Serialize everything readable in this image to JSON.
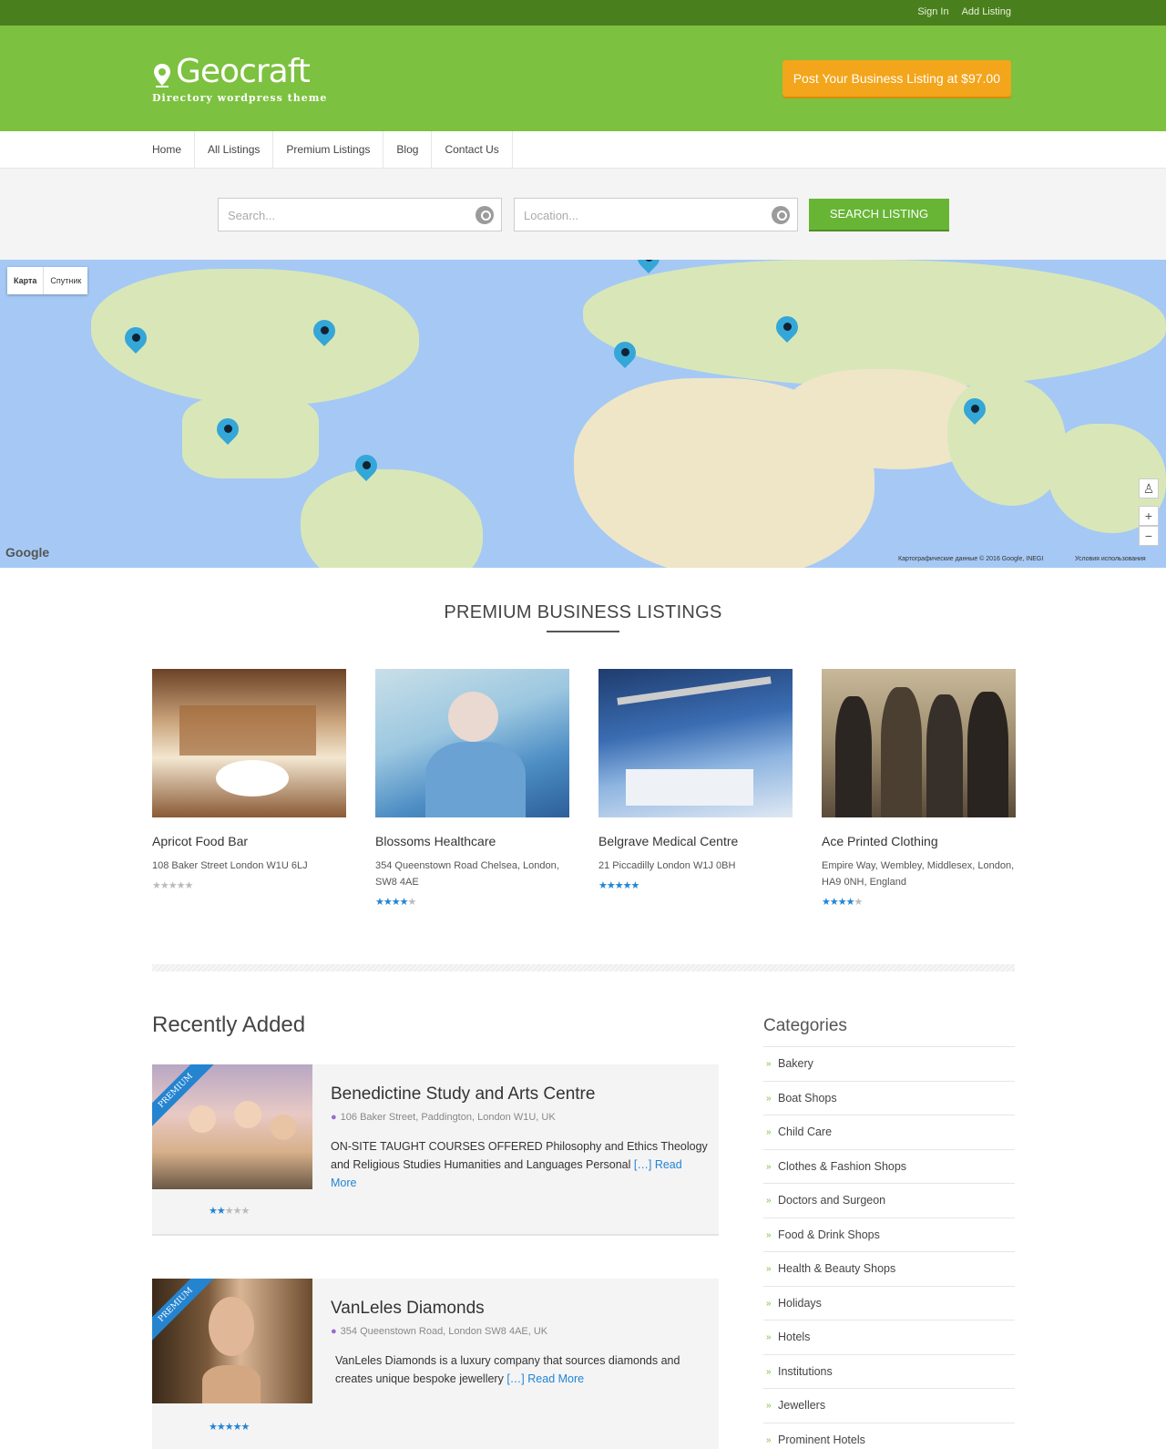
{
  "topbar": {
    "sign_in": "Sign In",
    "add_listing": "Add Listing"
  },
  "header": {
    "logo_name": "Geocraft",
    "logo_tagline": "Directory wordpress theme",
    "post_button": "Post Your Business Listing at $97.00"
  },
  "nav": [
    "Home",
    "All Listings",
    "Premium Listings",
    "Blog",
    "Contact Us"
  ],
  "search": {
    "keyword_placeholder": "Search...",
    "location_placeholder": "Location...",
    "button": "SEARCH LISTING"
  },
  "map": {
    "type_map": "Карта",
    "type_satellite": "Спутник",
    "google": "Google",
    "attribution": "Картографические данные © 2016 Google, INEGI",
    "terms": "Условия использования",
    "zoom_in": "+",
    "zoom_out": "−",
    "marker_count": 8
  },
  "premium": {
    "heading": "PREMIUM BUSINESS LISTINGS",
    "cards": [
      {
        "title": "Apricot Food Bar",
        "address": "108 Baker Street London W1U 6LJ",
        "rating": 0
      },
      {
        "title": "Blossoms Healthcare",
        "address": "354 Queenstown Road Chelsea, London, SW8 4AE",
        "rating": 4
      },
      {
        "title": "Belgrave Medical Centre",
        "address": "21 Piccadilly London W1J 0BH",
        "rating": 5
      },
      {
        "title": "Ace Printed Clothing",
        "address": "Empire Way, Wembley, Middlesex, London, HA9 0NH, England",
        "rating": 4
      }
    ]
  },
  "recent": {
    "heading": "Recently Added",
    "items": [
      {
        "badge": "PREMIUM",
        "title": "Benedictine Study and Arts Centre",
        "address": "106 Baker Street, Paddington, London W1U, UK",
        "excerpt": "ON-SITE TAUGHT COURSES OFFERED Philosophy and Ethics Theology and Religious Studies Humanities and Languages Personal",
        "ellipsis": "[…]",
        "read_more": "Read More",
        "rating": 2
      },
      {
        "badge": "PREMIUM",
        "title": "VanLeles Diamonds",
        "address": "354 Queenstown Road, London SW8 4AE, UK",
        "excerpt": "VanLeles Diamonds is a luxury company that sources diamonds and creates unique bespoke jewellery",
        "ellipsis": "[…]",
        "read_more": "Read More",
        "rating": 5
      }
    ]
  },
  "categories": {
    "heading": "Categories",
    "items": [
      "Bakery",
      "Boat Shops",
      "Child Care",
      "Clothes & Fashion Shops",
      "Doctors and Surgeon",
      "Food & Drink Shops",
      "Health & Beauty Shops",
      "Holidays",
      "Hotels",
      "Institutions",
      "Jewellers",
      "Prominent Hotels"
    ]
  },
  "colors": {
    "brand_green": "#7cc13f",
    "dark_green": "#4a7f1e",
    "orange": "#f3a51b",
    "link_blue": "#2284d5"
  }
}
